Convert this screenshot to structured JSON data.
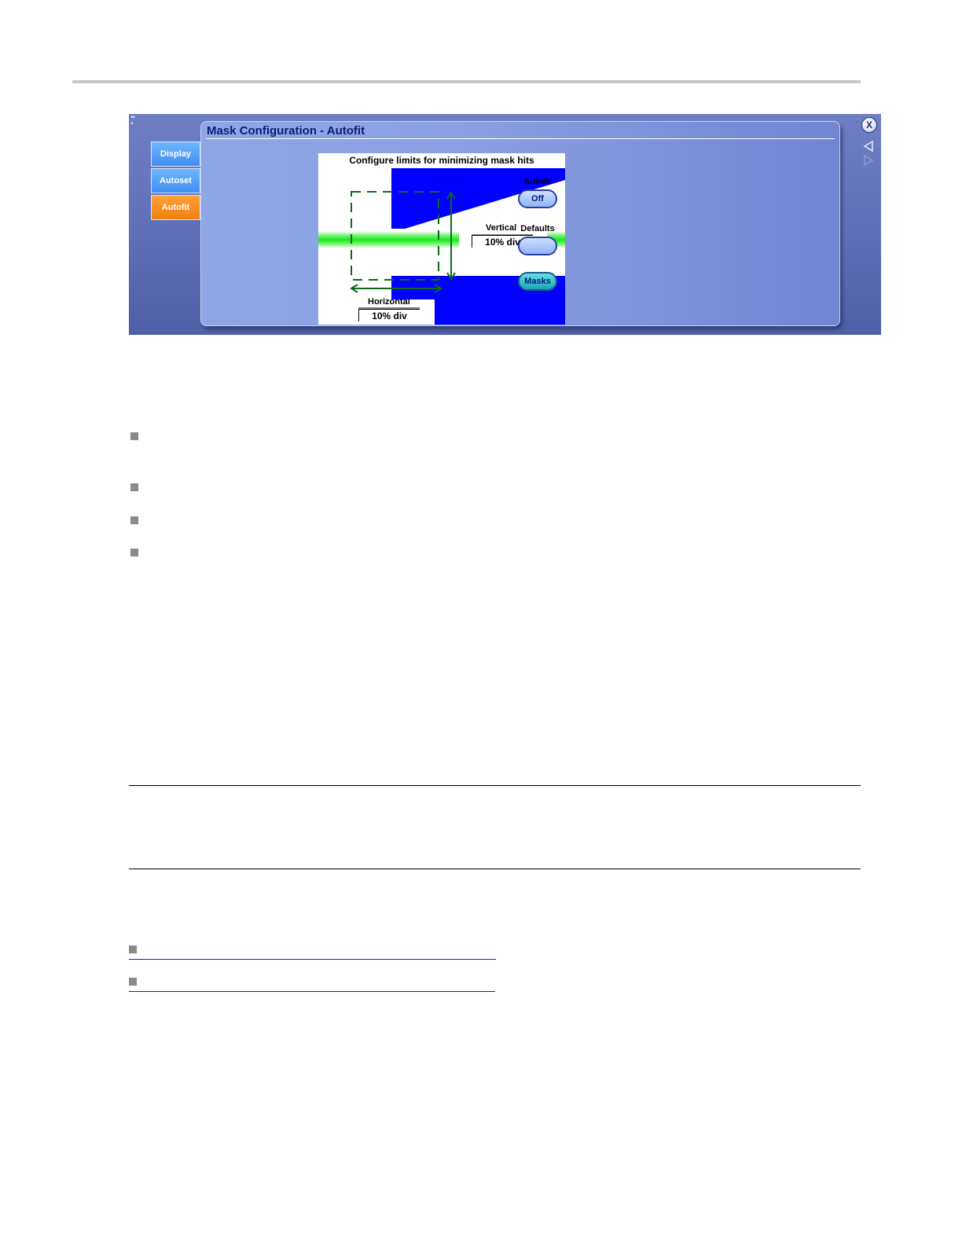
{
  "dialog": {
    "title": "Mask Configuration - Autofit",
    "tabs": [
      {
        "label": "Display",
        "active": false
      },
      {
        "label": "Autoset",
        "active": false
      },
      {
        "label": "Autofit",
        "active": true
      }
    ],
    "diagram": {
      "caption": "Configure limits for minimizing mask hits",
      "vertical_label": "Vertical",
      "vertical_value": "10% div",
      "horizontal_label": "Horizontal",
      "horizontal_value": "10% div"
    },
    "controls": {
      "autofit_label": "Autofit",
      "autofit_value": "Off",
      "defaults_label": "Defaults",
      "defaults_value": "",
      "masks_label": "Masks"
    },
    "window_buttons": {
      "close_label": "X",
      "icons": [
        "close-icon",
        "arrow-left-icon",
        "arrow-right-icon"
      ]
    }
  },
  "colors": {
    "mask_blue": "#0000ff",
    "signal_green": "#22ee22",
    "guide_green": "#0b6a1a",
    "tab_active": "#f28a1a",
    "tab_inactive": "#4f9ff8"
  }
}
